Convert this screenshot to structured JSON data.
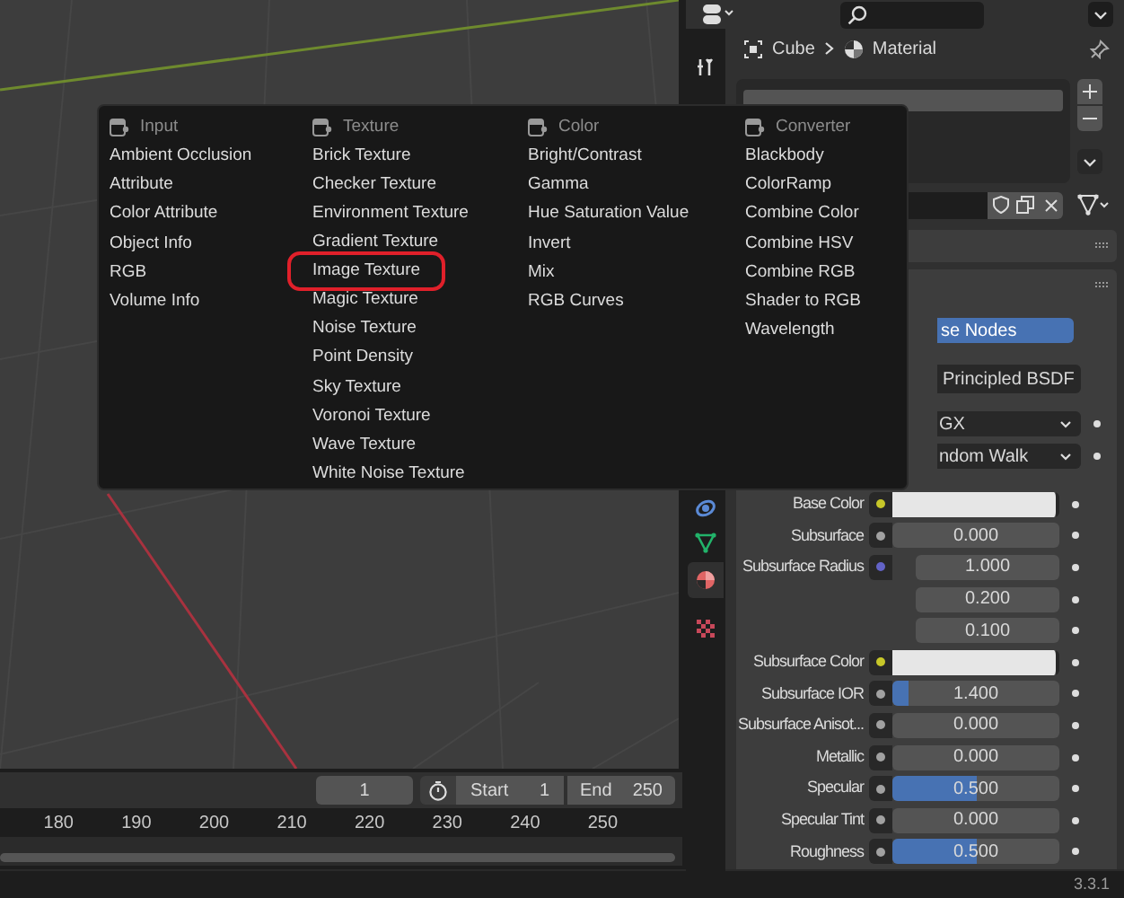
{
  "add_menu": {
    "columns": [
      {
        "heading": "Input",
        "items": [
          {
            "label": "Ambient Occlusion",
            "circled": false
          },
          {
            "label": "Attribute",
            "circled": false
          },
          {
            "label": "Color Attribute",
            "circled": false
          },
          {
            "label": "Object Info",
            "circled": false
          },
          {
            "label": "RGB",
            "circled": false
          },
          {
            "label": "Volume Info",
            "circled": false
          }
        ]
      },
      {
        "heading": "Texture",
        "items": [
          {
            "label": "Brick Texture",
            "circled": false
          },
          {
            "label": "Checker Texture",
            "circled": false
          },
          {
            "label": "Environment Texture",
            "circled": false
          },
          {
            "label": "Gradient Texture",
            "circled": false
          },
          {
            "label": "Image Texture",
            "circled": true
          },
          {
            "label": "Magic Texture",
            "circled": false
          },
          {
            "label": "Noise Texture",
            "circled": false
          },
          {
            "label": "Point Density",
            "circled": false
          },
          {
            "label": "Sky Texture",
            "circled": false
          },
          {
            "label": "Voronoi Texture",
            "circled": false
          },
          {
            "label": "Wave Texture",
            "circled": false
          },
          {
            "label": "White Noise Texture",
            "circled": false
          }
        ]
      },
      {
        "heading": "Color",
        "items": [
          {
            "label": "Bright/Contrast",
            "circled": false
          },
          {
            "label": "Gamma",
            "circled": false
          },
          {
            "label": "Hue Saturation Value",
            "circled": false
          },
          {
            "label": "Invert",
            "circled": false
          },
          {
            "label": "Mix",
            "circled": false
          },
          {
            "label": "RGB Curves",
            "circled": false
          }
        ]
      },
      {
        "heading": "Converter",
        "items": [
          {
            "label": "Blackbody",
            "circled": false
          },
          {
            "label": "ColorRamp",
            "circled": false
          },
          {
            "label": "Combine Color",
            "circled": false
          },
          {
            "label": "Combine HSV",
            "circled": false
          },
          {
            "label": "Combine RGB",
            "circled": false
          },
          {
            "label": "Shader to RGB",
            "circled": false
          },
          {
            "label": "Wavelength",
            "circled": false
          }
        ]
      }
    ]
  },
  "properties": {
    "breadcrumb": [
      "Cube",
      "Material"
    ],
    "tabs": [
      {
        "kind": "tool",
        "selected": false
      },
      {
        "kind": "physics",
        "selected": false
      },
      {
        "kind": "data",
        "selected": false
      },
      {
        "kind": "material",
        "selected": true
      },
      {
        "kind": "texture",
        "selected": false
      }
    ],
    "use_nodes_button": "se Nodes",
    "surface_field": "Principled BSDF",
    "distribution_dropdown": "GX",
    "subsurface_method_dropdown": "ndom Walk",
    "inputs": [
      {
        "label": "Base Color",
        "kind": "color",
        "color": "#c7c729"
      },
      {
        "label": "Subsurface",
        "kind": "number",
        "color": "#a1a1a1",
        "reading": "0.000"
      },
      {
        "label": "Subsurface Radius",
        "kind": "vector",
        "color": "#6363c7",
        "values": [
          "1.000",
          "0.200",
          "0.100"
        ]
      },
      {
        "label": "Subsurface Color",
        "kind": "color",
        "color": "#c7c729"
      },
      {
        "label": "Subsurface IOR",
        "kind": "slider",
        "color": "#a1a1a1",
        "level": 0.1,
        "reading": "1.400"
      },
      {
        "label": "Subsurface Anisot...",
        "kind": "number",
        "color": "#a1a1a1",
        "reading": "0.000"
      },
      {
        "label": "Metallic",
        "kind": "number",
        "color": "#a1a1a1",
        "reading": "0.000"
      },
      {
        "label": "Specular",
        "kind": "slider",
        "color": "#a1a1a1",
        "level": 0.5,
        "reading": "0.500"
      },
      {
        "label": "Specular Tint",
        "kind": "number",
        "color": "#a1a1a1",
        "reading": "0.000"
      },
      {
        "label": "Roughness",
        "kind": "slider",
        "color": "#a1a1a1",
        "level": 0.5,
        "reading": "0.500"
      }
    ]
  },
  "timeline": {
    "current_frame": "1",
    "start_label": "Start",
    "start": "1",
    "end_label": "End",
    "end": "250",
    "ruler": [
      "180",
      "190",
      "200",
      "210",
      "220",
      "230",
      "240",
      "250"
    ]
  },
  "status_bar": {
    "version": "3.3.1"
  }
}
